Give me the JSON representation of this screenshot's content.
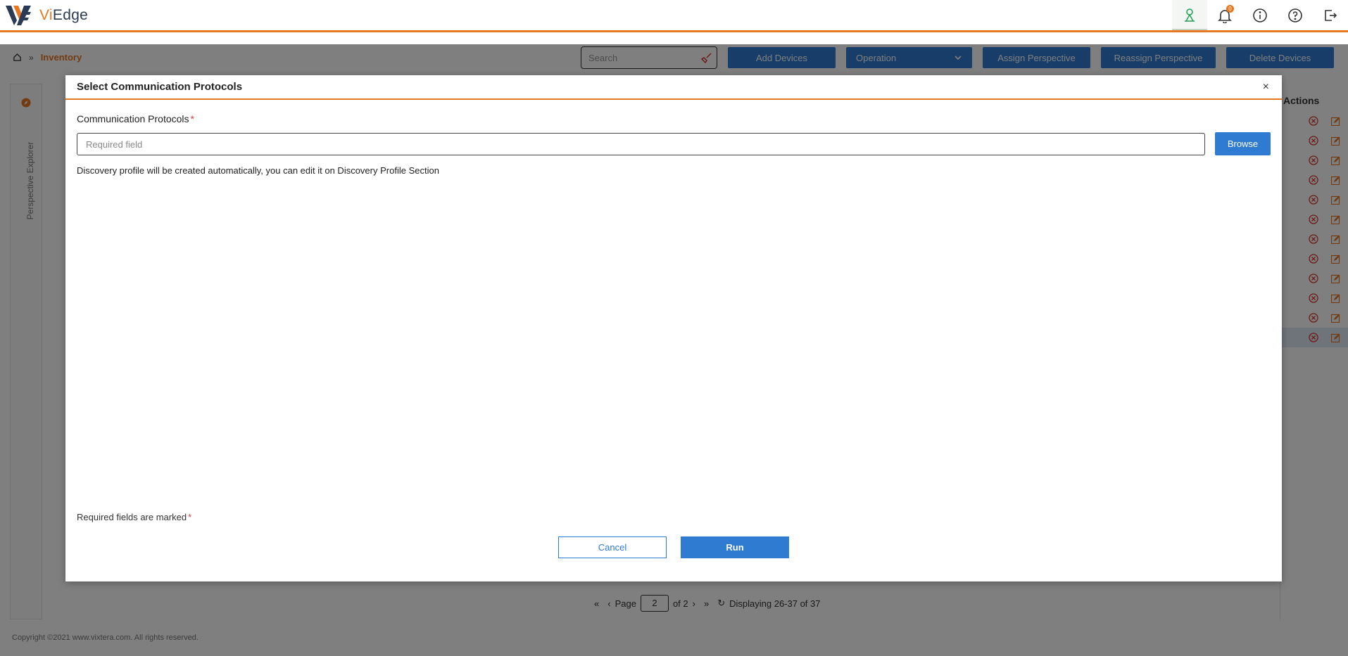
{
  "app": {
    "logo_prefix": "Vi",
    "logo_suffix": "Edge",
    "brand_color": "#e87722",
    "accent_color": "#2f7bd1"
  },
  "header_icons": [
    {
      "name": "perspective-icon",
      "active": true
    },
    {
      "name": "bell-icon",
      "badge": "0"
    },
    {
      "name": "info-icon"
    },
    {
      "name": "help-icon"
    },
    {
      "name": "logout-icon"
    }
  ],
  "breadcrumb": {
    "home_icon": "home-icon",
    "separator": "»",
    "current": "Inventory"
  },
  "toolbar": {
    "search_placeholder": "Search",
    "add_devices": "Add Devices",
    "operation": "Operation",
    "assign_perspective": "Assign Perspective",
    "reassign_perspective": "Reassign Perspective",
    "delete_devices": "Delete Devices"
  },
  "sidebar": {
    "explorer_label": "Perspective Explorer"
  },
  "grid": {
    "actions_header": "Actions",
    "row_count": 12,
    "highlighted_row": 11
  },
  "pager": {
    "page_label": "Page",
    "current_page": "2",
    "of_label": "of 2",
    "display_info": "Displaying 26-37 of 37"
  },
  "footer": {
    "copyright": "Copyright ©2021 www.vixtera.com. All rights reserved."
  },
  "modal": {
    "title": "Select Communication Protocols",
    "close": "×",
    "field_label": "Communication Protocols",
    "required_star": "*",
    "field_placeholder": "Required field",
    "field_value": "",
    "browse_label": "Browse",
    "info_text": "Discovery profile will be created automatically, you can edit it on Discovery Profile Section",
    "required_note": "Required fields are marked",
    "cancel_label": "Cancel",
    "run_label": "Run"
  }
}
